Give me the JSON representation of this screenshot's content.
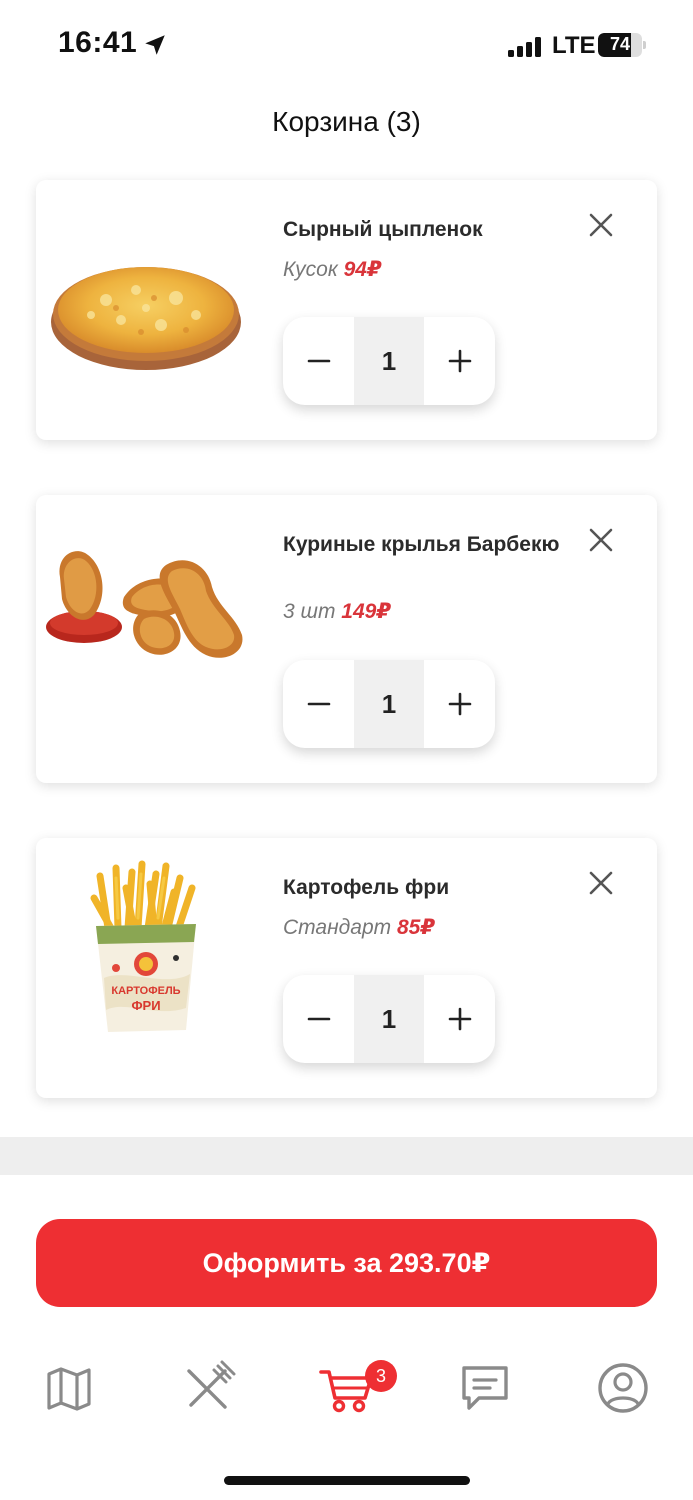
{
  "status_bar": {
    "time": "16:41",
    "network": "LTE",
    "battery": "74",
    "battery_level": 0.74
  },
  "header": {
    "title": "Корзина (3)"
  },
  "cart": {
    "items": [
      {
        "name": "Сырный цыпленок",
        "variant": "Кусок",
        "price": "94₽",
        "quantity": "1",
        "image": "cheese-chicken-pizza-image"
      },
      {
        "name": "Куриные крылья Барбекю",
        "variant": "3 шт",
        "price": "149₽",
        "quantity": "1",
        "image": "bbq-chicken-wings-image"
      },
      {
        "name": "Картофель фри",
        "variant": "Стандарт",
        "price": "85₽",
        "quantity": "1",
        "image": "french-fries-image",
        "image_text": "КАРТОФЕЛЬ ФРИ"
      }
    ]
  },
  "checkout": {
    "label": "Оформить за 293.70₽"
  },
  "tab_bar": {
    "items": [
      {
        "icon": "map-icon",
        "active": false
      },
      {
        "icon": "menu-fork-knife-icon",
        "active": false
      },
      {
        "icon": "cart-icon",
        "active": true,
        "badge": "3"
      },
      {
        "icon": "chat-icon",
        "active": false
      },
      {
        "icon": "profile-icon",
        "active": false
      }
    ]
  },
  "colors": {
    "accent": "#ee2f33",
    "price": "#d9343a",
    "inactive_icon": "#8a8a8a"
  },
  "icons": {
    "remove": "close-icon",
    "decrease": "minus-icon",
    "increase": "plus-icon"
  }
}
